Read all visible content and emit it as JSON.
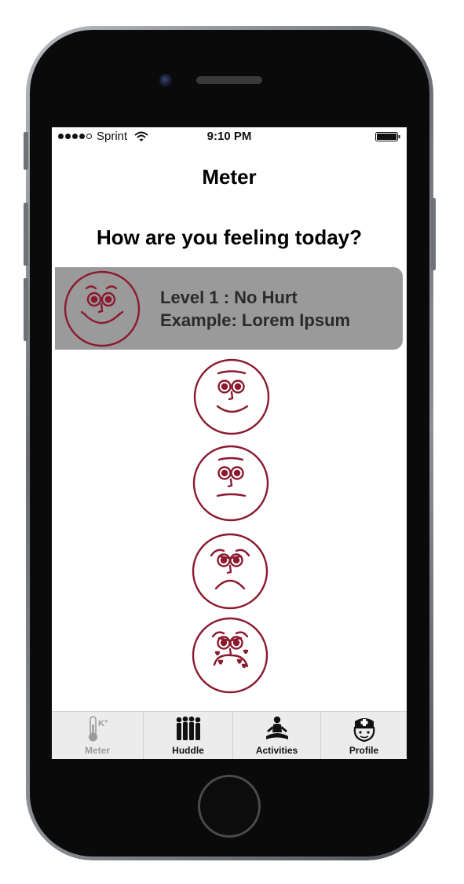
{
  "status_bar": {
    "carrier": "Sprint",
    "time": "9:10 PM",
    "signal_bars": 4,
    "signal_total": 5
  },
  "header": {
    "title": "Meter"
  },
  "main": {
    "question": "How are you feeling today?",
    "selected_level": {
      "line1": "Level 1 : No Hurt",
      "line2": "Example: Lorem Ipsum"
    },
    "faces": [
      {
        "level": 1,
        "icon": "very-happy-face-icon"
      },
      {
        "level": 2,
        "icon": "happy-face-icon"
      },
      {
        "level": 3,
        "icon": "neutral-face-icon"
      },
      {
        "level": 4,
        "icon": "sad-face-icon"
      },
      {
        "level": 5,
        "icon": "crying-face-icon"
      }
    ]
  },
  "tabs": [
    {
      "label": "Meter",
      "icon": "thermometer-icon",
      "active": true
    },
    {
      "label": "Huddle",
      "icon": "group-people-icon",
      "active": false
    },
    {
      "label": "Activities",
      "icon": "meditation-icon",
      "active": false
    },
    {
      "label": "Profile",
      "icon": "nurse-icon",
      "active": false
    }
  ],
  "colors": {
    "face_stroke": "#8b1a2e",
    "selected_background": "#9a9a9a",
    "tab_bar_background": "#ececec",
    "inactive_tab_label": "#9b9b9b"
  }
}
